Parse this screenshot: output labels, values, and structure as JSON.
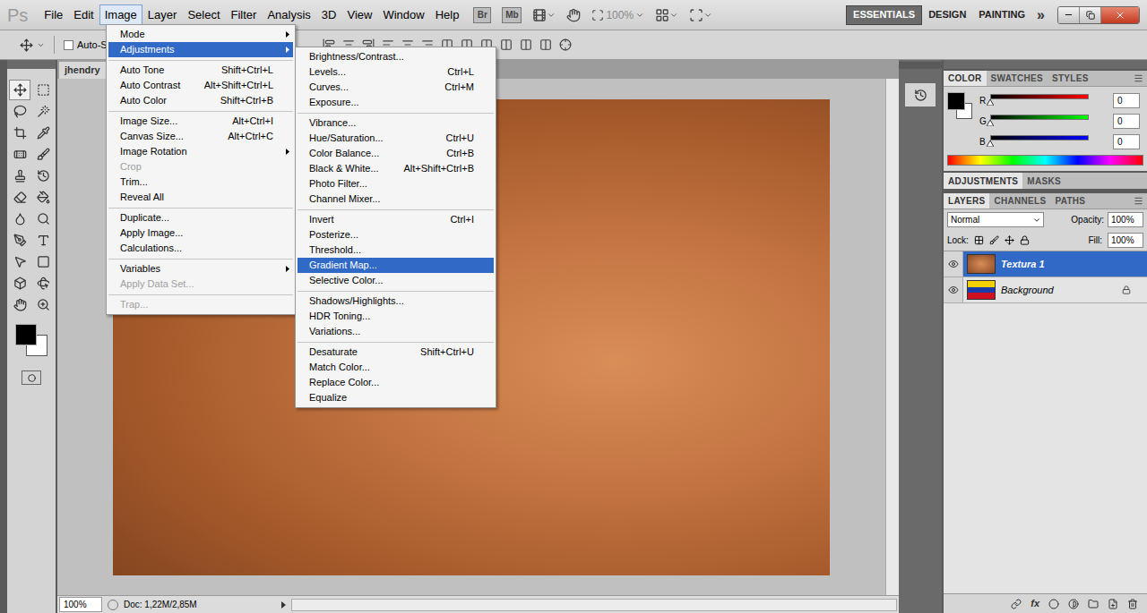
{
  "app": {
    "logo": "Ps"
  },
  "menu_bar": [
    {
      "label": "File",
      "selected": false
    },
    {
      "label": "Edit",
      "selected": false
    },
    {
      "label": "Image",
      "selected": true
    },
    {
      "label": "Layer",
      "selected": false
    },
    {
      "label": "Select",
      "selected": false
    },
    {
      "label": "Filter",
      "selected": false
    },
    {
      "label": "Analysis",
      "selected": false
    },
    {
      "label": "3D",
      "selected": false
    },
    {
      "label": "View",
      "selected": false
    },
    {
      "label": "Window",
      "selected": false
    },
    {
      "label": "Help",
      "selected": false
    }
  ],
  "app_bar": {
    "bridge": "Br",
    "mini_bridge": "Mb",
    "zoom": "100%"
  },
  "workspaces": [
    {
      "label": "ESSENTIALS",
      "selected": true
    },
    {
      "label": "DESIGN",
      "selected": false
    },
    {
      "label": "PAINTING",
      "selected": false
    }
  ],
  "workspace_more": "»",
  "options_bar": {
    "auto_select": {
      "label": "Auto-Se",
      "checked": false
    }
  },
  "document_tab": {
    "title": "jhendry"
  },
  "image_menu": [
    {
      "kind": "item",
      "label": "Mode",
      "shortcut": "",
      "submenu": true,
      "disabled": false,
      "selected": false
    },
    {
      "kind": "item",
      "label": "Adjustments",
      "shortcut": "",
      "submenu": true,
      "disabled": false,
      "selected": true
    },
    {
      "kind": "separator"
    },
    {
      "kind": "item",
      "label": "Auto Tone",
      "shortcut": "Shift+Ctrl+L",
      "submenu": false,
      "disabled": false,
      "selected": false
    },
    {
      "kind": "item",
      "label": "Auto Contrast",
      "shortcut": "Alt+Shift+Ctrl+L",
      "submenu": false,
      "disabled": false,
      "selected": false
    },
    {
      "kind": "item",
      "label": "Auto Color",
      "shortcut": "Shift+Ctrl+B",
      "submenu": false,
      "disabled": false,
      "selected": false
    },
    {
      "kind": "separator"
    },
    {
      "kind": "item",
      "label": "Image Size...",
      "shortcut": "Alt+Ctrl+I",
      "submenu": false,
      "disabled": false,
      "selected": false
    },
    {
      "kind": "item",
      "label": "Canvas Size...",
      "shortcut": "Alt+Ctrl+C",
      "submenu": false,
      "disabled": false,
      "selected": false
    },
    {
      "kind": "item",
      "label": "Image Rotation",
      "shortcut": "",
      "submenu": true,
      "disabled": false,
      "selected": false
    },
    {
      "kind": "item",
      "label": "Crop",
      "shortcut": "",
      "submenu": false,
      "disabled": true,
      "selected": false
    },
    {
      "kind": "item",
      "label": "Trim...",
      "shortcut": "",
      "submenu": false,
      "disabled": false,
      "selected": false
    },
    {
      "kind": "item",
      "label": "Reveal All",
      "shortcut": "",
      "submenu": false,
      "disabled": false,
      "selected": false
    },
    {
      "kind": "separator"
    },
    {
      "kind": "item",
      "label": "Duplicate...",
      "shortcut": "",
      "submenu": false,
      "disabled": false,
      "selected": false
    },
    {
      "kind": "item",
      "label": "Apply Image...",
      "shortcut": "",
      "submenu": false,
      "disabled": false,
      "selected": false
    },
    {
      "kind": "item",
      "label": "Calculations...",
      "shortcut": "",
      "submenu": false,
      "disabled": false,
      "selected": false
    },
    {
      "kind": "separator"
    },
    {
      "kind": "item",
      "label": "Variables",
      "shortcut": "",
      "submenu": true,
      "disabled": false,
      "selected": false
    },
    {
      "kind": "item",
      "label": "Apply Data Set...",
      "shortcut": "",
      "submenu": false,
      "disabled": true,
      "selected": false
    },
    {
      "kind": "separator"
    },
    {
      "kind": "item",
      "label": "Trap...",
      "shortcut": "",
      "submenu": false,
      "disabled": true,
      "selected": false
    }
  ],
  "adjustments_menu": [
    {
      "kind": "item",
      "label": "Brightness/Contrast...",
      "shortcut": "",
      "submenu": false,
      "disabled": false,
      "selected": false
    },
    {
      "kind": "item",
      "label": "Levels...",
      "shortcut": "Ctrl+L",
      "submenu": false,
      "disabled": false,
      "selected": false
    },
    {
      "kind": "item",
      "label": "Curves...",
      "shortcut": "Ctrl+M",
      "submenu": false,
      "disabled": false,
      "selected": false
    },
    {
      "kind": "item",
      "label": "Exposure...",
      "shortcut": "",
      "submenu": false,
      "disabled": false,
      "selected": false
    },
    {
      "kind": "separator"
    },
    {
      "kind": "item",
      "label": "Vibrance...",
      "shortcut": "",
      "submenu": false,
      "disabled": false,
      "selected": false
    },
    {
      "kind": "item",
      "label": "Hue/Saturation...",
      "shortcut": "Ctrl+U",
      "submenu": false,
      "disabled": false,
      "selected": false
    },
    {
      "kind": "item",
      "label": "Color Balance...",
      "shortcut": "Ctrl+B",
      "submenu": false,
      "disabled": false,
      "selected": false
    },
    {
      "kind": "item",
      "label": "Black & White...",
      "shortcut": "Alt+Shift+Ctrl+B",
      "submenu": false,
      "disabled": false,
      "selected": false
    },
    {
      "kind": "item",
      "label": "Photo Filter...",
      "shortcut": "",
      "submenu": false,
      "disabled": false,
      "selected": false
    },
    {
      "kind": "item",
      "label": "Channel Mixer...",
      "shortcut": "",
      "submenu": false,
      "disabled": false,
      "selected": false
    },
    {
      "kind": "separator"
    },
    {
      "kind": "item",
      "label": "Invert",
      "shortcut": "Ctrl+I",
      "submenu": false,
      "disabled": false,
      "selected": false
    },
    {
      "kind": "item",
      "label": "Posterize...",
      "shortcut": "",
      "submenu": false,
      "disabled": false,
      "selected": false
    },
    {
      "kind": "item",
      "label": "Threshold...",
      "shortcut": "",
      "submenu": false,
      "disabled": false,
      "selected": false
    },
    {
      "kind": "item",
      "label": "Gradient Map...",
      "shortcut": "",
      "submenu": false,
      "disabled": false,
      "selected": true
    },
    {
      "kind": "item",
      "label": "Selective Color...",
      "shortcut": "",
      "submenu": false,
      "disabled": false,
      "selected": false
    },
    {
      "kind": "separator"
    },
    {
      "kind": "item",
      "label": "Shadows/Highlights...",
      "shortcut": "",
      "submenu": false,
      "disabled": false,
      "selected": false
    },
    {
      "kind": "item",
      "label": "HDR Toning...",
      "shortcut": "",
      "submenu": false,
      "disabled": false,
      "selected": false
    },
    {
      "kind": "item",
      "label": "Variations...",
      "shortcut": "",
      "submenu": false,
      "disabled": false,
      "selected": false
    },
    {
      "kind": "separator"
    },
    {
      "kind": "item",
      "label": "Desaturate",
      "shortcut": "Shift+Ctrl+U",
      "submenu": false,
      "disabled": false,
      "selected": false
    },
    {
      "kind": "item",
      "label": "Match Color...",
      "shortcut": "",
      "submenu": false,
      "disabled": false,
      "selected": false
    },
    {
      "kind": "item",
      "label": "Replace Color...",
      "shortcut": "",
      "submenu": false,
      "disabled": false,
      "selected": false
    },
    {
      "kind": "item",
      "label": "Equalize",
      "shortcut": "",
      "submenu": false,
      "disabled": false,
      "selected": false
    }
  ],
  "color_panel": {
    "tabs": [
      {
        "label": "COLOR",
        "selected": true
      },
      {
        "label": "SWATCHES",
        "selected": false
      },
      {
        "label": "STYLES",
        "selected": false
      }
    ],
    "foreground": "#000000",
    "background": "#ffffff",
    "channels": [
      {
        "name": "R",
        "value": "0",
        "level": 0,
        "color": "#ff0000"
      },
      {
        "name": "G",
        "value": "0",
        "level": 0,
        "color": "#00ff00"
      },
      {
        "name": "B",
        "value": "0",
        "level": 0,
        "color": "#0000ff"
      }
    ]
  },
  "adjustments_panel": {
    "tabs": [
      {
        "label": "ADJUSTMENTS",
        "selected": true
      },
      {
        "label": "MASKS",
        "selected": false
      }
    ]
  },
  "layers_panel": {
    "tabs": [
      {
        "label": "LAYERS",
        "selected": true
      },
      {
        "label": "CHANNELS",
        "selected": false
      },
      {
        "label": "PATHS",
        "selected": false
      }
    ],
    "blend_mode": "Normal",
    "opacity_label": "Opacity:",
    "opacity": "100%",
    "lock_label": "Lock:",
    "fill_label": "Fill:",
    "fill": "100%",
    "layers": [
      {
        "name": "Textura 1",
        "selected": true,
        "visible": true,
        "locked": false,
        "kind": "texture"
      },
      {
        "name": "Background",
        "selected": false,
        "visible": true,
        "locked": true,
        "kind": "flag"
      }
    ],
    "fx": "fx"
  },
  "status_bar": {
    "zoom": "100%",
    "doc": "Doc: 1,22M/2,85M"
  }
}
